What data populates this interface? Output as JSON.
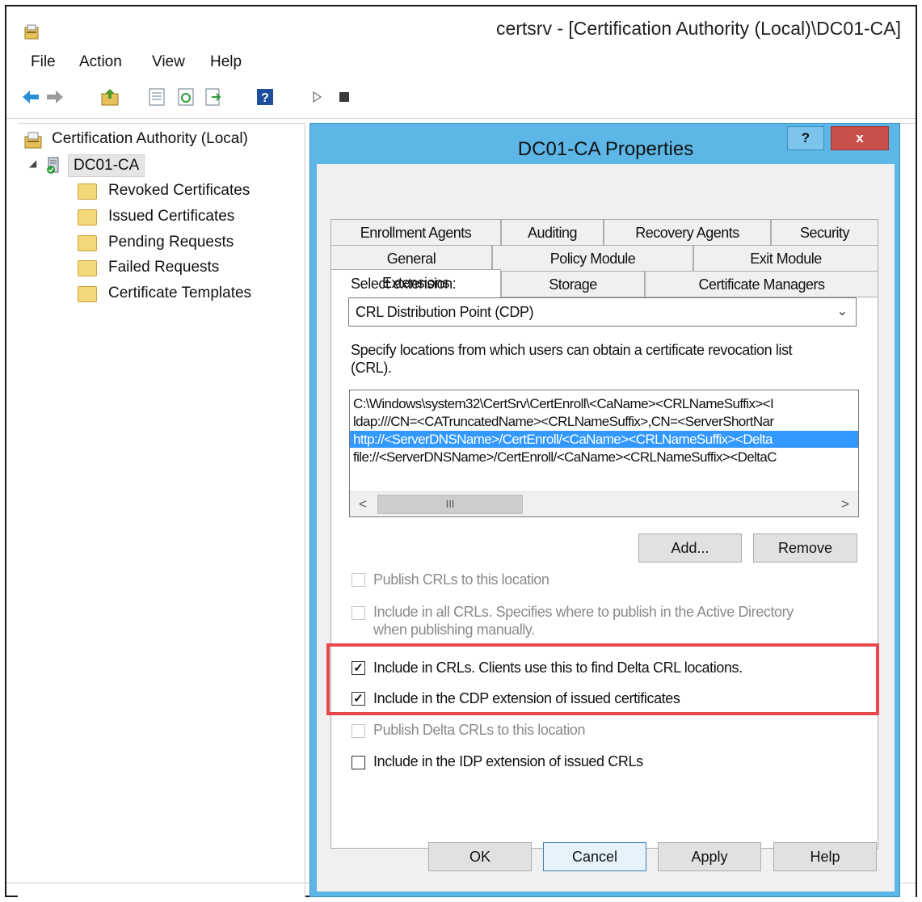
{
  "window": {
    "title": "certsrv - [Certification Authority (Local)\\DC01-CA]"
  },
  "menu": [
    "File",
    "Action",
    "View",
    "Help"
  ],
  "toolbar": {
    "icons": [
      "back-arrow-icon",
      "forward-arrow-icon",
      "up-folder-icon",
      "properties-icon",
      "refresh-icon",
      "export-icon",
      "help-icon",
      "start-icon",
      "stop-icon"
    ],
    "colors": {
      "arrow": "#2b8fd6",
      "help": "#1d4f9c"
    }
  },
  "tree": {
    "root": "Certification Authority (Local)",
    "ca": "DC01-CA",
    "folders": [
      "Revoked Certificates",
      "Issued Certificates",
      "Pending Requests",
      "Failed Requests",
      "Certificate Templates"
    ]
  },
  "dialog": {
    "title": "DC01-CA Properties",
    "help_glyph": "?",
    "close_glyph": "x",
    "tabs_row1": [
      "Enrollment Agents",
      "Auditing",
      "Recovery Agents",
      "Security"
    ],
    "tabs_row2": [
      "General",
      "Policy Module",
      "Exit Module"
    ],
    "tabs_row3": [
      "Extensions",
      "Storage",
      "Certificate Managers"
    ],
    "active_tab": "Extensions",
    "select_label": "Select extension:",
    "select_value": "CRL Distribution Point (CDP)",
    "specify_text_line1": "Specify locations from which users can obtain a certificate revocation list",
    "specify_text_line2": "(CRL).",
    "locations": [
      "C:\\Windows\\system32\\CertSrv\\CertEnroll\\<CaName><CRLNameSuffix><I",
      "ldap:///CN=<CATruncatedName><CRLNameSuffix>,CN=<ServerShortNar",
      "http://<ServerDNSName>/CertEnroll/<CaName><CRLNameSuffix><Delta",
      "file://<ServerDNSName>/CertEnroll/<CaName><CRLNameSuffix><DeltaC"
    ],
    "selected_location_index": 2,
    "scroll_left": "<",
    "scroll_right": ">",
    "scroll_thumb": "III",
    "add_button": "Add...",
    "remove_button": "Remove",
    "options": [
      {
        "label": "Publish CRLs to this location",
        "checked": false,
        "enabled": false
      },
      {
        "label": "Include in all CRLs. Specifies where to publish in the Active Directory",
        "label2": "when publishing manually.",
        "checked": false,
        "enabled": false
      },
      {
        "label": "Include in CRLs. Clients use this to find Delta CRL locations.",
        "checked": true,
        "enabled": true
      },
      {
        "label": "Include in the CDP extension of issued certificates",
        "checked": true,
        "enabled": true
      },
      {
        "label": "Publish Delta CRLs to this location",
        "checked": false,
        "enabled": false
      },
      {
        "label": "Include in the IDP extension of issued CRLs",
        "checked": false,
        "enabled": true
      }
    ],
    "buttons": {
      "ok": "OK",
      "cancel": "Cancel",
      "apply": "Apply",
      "help": "Help"
    },
    "colors": {
      "frame": "#5cb6e6",
      "close": "#c7504a",
      "selection": "#3399ff",
      "highlight_box": "#e8474c"
    }
  }
}
